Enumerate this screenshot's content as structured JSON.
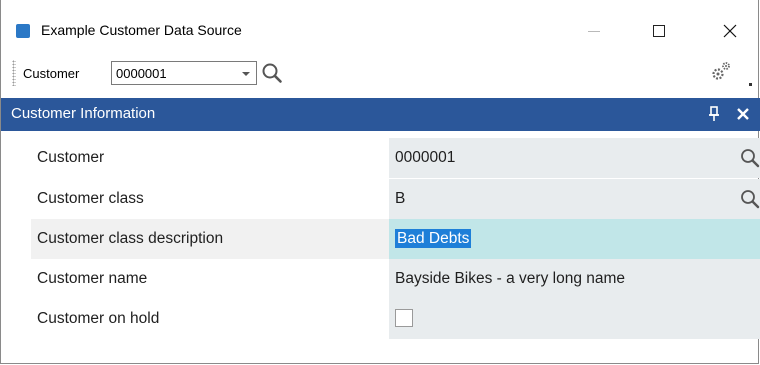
{
  "window": {
    "title": "Example Customer Data Source",
    "icon": "app-icon",
    "controls": [
      "minimize-icon",
      "maximize-icon",
      "close-icon"
    ]
  },
  "toolbar": {
    "customer_label": "Customer",
    "customer_value": "0000001",
    "search_icon": "search-icon",
    "settings_icon": "gear-icon"
  },
  "panel": {
    "title": "Customer Information",
    "pin_icon": "pin-icon",
    "close_icon": "close-icon",
    "accent_color": "#2b579a"
  },
  "properties": [
    {
      "label": "Customer",
      "value": "0000001",
      "lookup": true
    },
    {
      "label": "Customer class",
      "value": "B",
      "lookup": true
    },
    {
      "label": "Customer class description",
      "value": "Bad Debts",
      "selected": true
    },
    {
      "label": "Customer name",
      "value": "Bayside Bikes - a very long name"
    },
    {
      "label": "Customer on hold",
      "value": "",
      "type": "checkbox",
      "checked": false
    }
  ]
}
